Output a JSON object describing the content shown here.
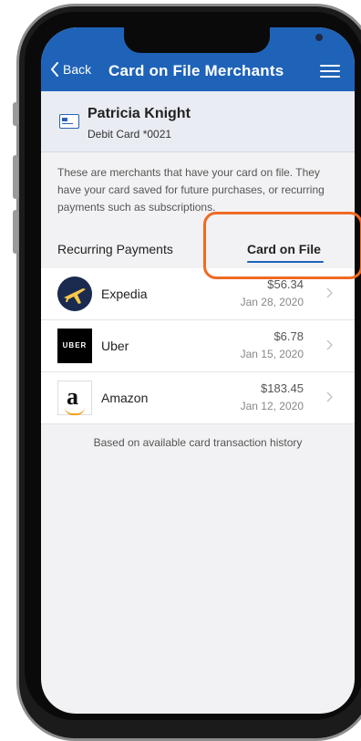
{
  "nav": {
    "back_label": "Back",
    "title": "Card on File Merchants"
  },
  "account": {
    "name": "Patricia Knight",
    "card": "Debit Card *0021"
  },
  "info_text": "These are merchants that have your card on file. They have your card saved for future purchases, or recurring payments such as subscriptions.",
  "tabs": [
    {
      "label": "Recurring Payments",
      "selected": false
    },
    {
      "label": "Card on File",
      "selected": true
    }
  ],
  "merchants": [
    {
      "name": "Expedia",
      "amount": "$56.34",
      "date": "Jan 28, 2020",
      "logo": "expedia-logo"
    },
    {
      "name": "Uber",
      "amount": "$6.78",
      "date": "Jan 15, 2020",
      "logo": "uber-logo",
      "logo_text": "UBER"
    },
    {
      "name": "Amazon",
      "amount": "$183.45",
      "date": "Jan 12, 2020",
      "logo": "amazon-logo",
      "logo_text": "a"
    }
  ],
  "footer_note": "Based on available card transaction history",
  "colors": {
    "nav_blue": "#1f63b8",
    "highlight_orange": "#ef6a22",
    "background": "#f2f2f4"
  }
}
